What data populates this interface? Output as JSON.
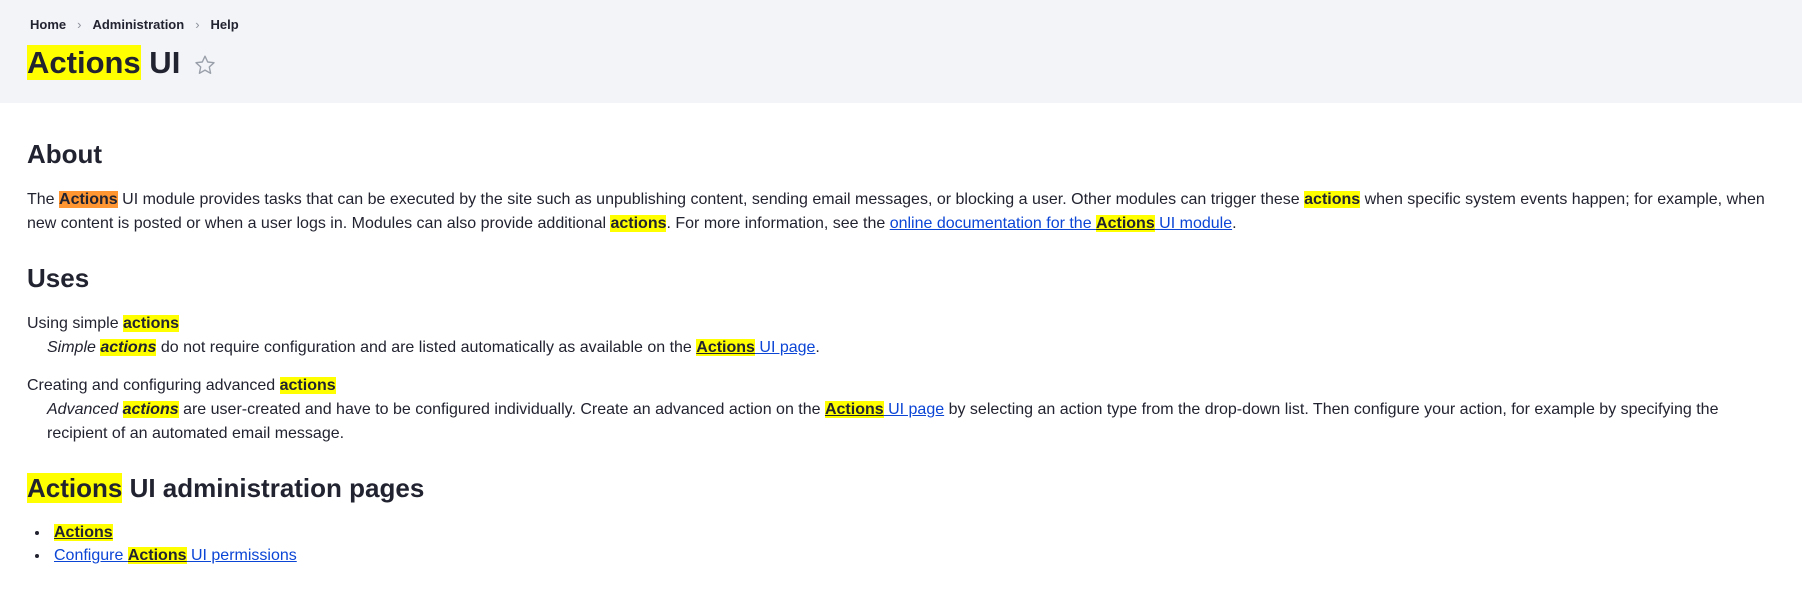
{
  "colors": {
    "header_bg": "#f3f4f8",
    "text": "#222330",
    "link": "#0b45d6",
    "highlight_match": "#ffff00",
    "highlight_active_match": "#ff9632",
    "star_icon": "#9aa0aa"
  },
  "breadcrumb": {
    "separator": "›",
    "items": [
      {
        "label": "Home"
      },
      {
        "label": "Administration"
      },
      {
        "label": "Help"
      }
    ]
  },
  "title": {
    "bookmark_icon": "star-outline",
    "segments": [
      {
        "t": "Actions",
        "hl": "yellow"
      },
      {
        "t": " UI"
      }
    ]
  },
  "about": {
    "heading": "About",
    "paragraph": [
      {
        "t": "The "
      },
      {
        "t": "Actions",
        "hl": "orange",
        "b": true
      },
      {
        "t": " UI module provides tasks that can be executed by the site such as unpublishing content, sending email messages, or blocking a user. Other modules can trigger these "
      },
      {
        "t": "actions",
        "hl": "yellow",
        "b": true
      },
      {
        "t": " when specific system events happen; for example, when new content is posted or when a user logs in. Modules can also provide additional "
      },
      {
        "t": "actions",
        "hl": "yellow",
        "b": true
      },
      {
        "t": ". For more information, see the "
      },
      {
        "t": "online documentation for the ",
        "link": true
      },
      {
        "t": "Actions",
        "link": true,
        "hl": "yellow",
        "b": true
      },
      {
        "t": " UI module",
        "link": true
      },
      {
        "t": "."
      }
    ]
  },
  "uses": {
    "heading": "Uses",
    "entries": [
      {
        "term": [
          {
            "t": "Using simple "
          },
          {
            "t": "actions",
            "hl": "yellow",
            "b": true
          }
        ],
        "definition": [
          {
            "t": "Simple ",
            "em": true
          },
          {
            "t": "actions",
            "em": true,
            "hl": "yellow",
            "b": true
          },
          {
            "t": " do not require configuration and are listed automatically as available on the "
          },
          {
            "t": "Actions",
            "link": true,
            "hl": "yellow",
            "b": true
          },
          {
            "t": " UI page",
            "link": true
          },
          {
            "t": "."
          }
        ]
      },
      {
        "term": [
          {
            "t": "Creating and configuring advanced "
          },
          {
            "t": "actions",
            "hl": "yellow",
            "b": true
          }
        ],
        "definition": [
          {
            "t": "Advanced ",
            "em": true
          },
          {
            "t": "actions",
            "em": true,
            "hl": "yellow",
            "b": true
          },
          {
            "t": " are user-created and have to be configured individually. Create an advanced action on the "
          },
          {
            "t": "Actions",
            "link": true,
            "hl": "yellow",
            "b": true
          },
          {
            "t": " UI page",
            "link": true
          },
          {
            "t": " by selecting an action type from the drop-down list. Then configure your action, for example by specifying the recipient of an automated email message."
          }
        ]
      }
    ]
  },
  "admin_pages": {
    "heading": [
      {
        "t": "Actions",
        "hl": "yellow"
      },
      {
        "t": " UI administration pages"
      }
    ],
    "links": [
      {
        "segments": [
          {
            "t": "Actions",
            "link": true,
            "hl": "yellow",
            "b": true
          }
        ]
      },
      {
        "segments": [
          {
            "t": "Configure ",
            "link": true
          },
          {
            "t": "Actions",
            "link": true,
            "hl": "yellow",
            "b": true
          },
          {
            "t": " UI permissions",
            "link": true
          }
        ]
      }
    ]
  }
}
